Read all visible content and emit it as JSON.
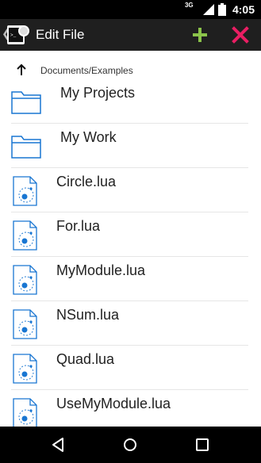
{
  "status_bar": {
    "network": "3G",
    "time": "4:05"
  },
  "app_bar": {
    "title": "Edit File",
    "icons": {
      "up": "chevron-left-icon",
      "logo": "terminal-app-icon",
      "add": "plus-icon",
      "close": "close-icon"
    },
    "colors": {
      "add": "#8bc34a",
      "close": "#e91e63"
    }
  },
  "breadcrumb": {
    "path": "Documents/Examples",
    "icon": "arrow-up-icon"
  },
  "items": [
    {
      "type": "folder",
      "name": "My Projects"
    },
    {
      "type": "folder",
      "name": "My Work"
    },
    {
      "type": "file",
      "name": "Circle.lua"
    },
    {
      "type": "file",
      "name": "For.lua"
    },
    {
      "type": "file",
      "name": "MyModule.lua"
    },
    {
      "type": "file",
      "name": "NSum.lua"
    },
    {
      "type": "file",
      "name": "Quad.lua"
    },
    {
      "type": "file",
      "name": "UseMyModule.lua"
    }
  ],
  "nav_bar": {
    "icons": [
      "back-triangle-icon",
      "home-circle-icon",
      "recents-square-icon"
    ]
  },
  "colors": {
    "status_bar": "#000000",
    "app_bar": "#1f1f1f",
    "icon_blue": "#1976d2"
  }
}
